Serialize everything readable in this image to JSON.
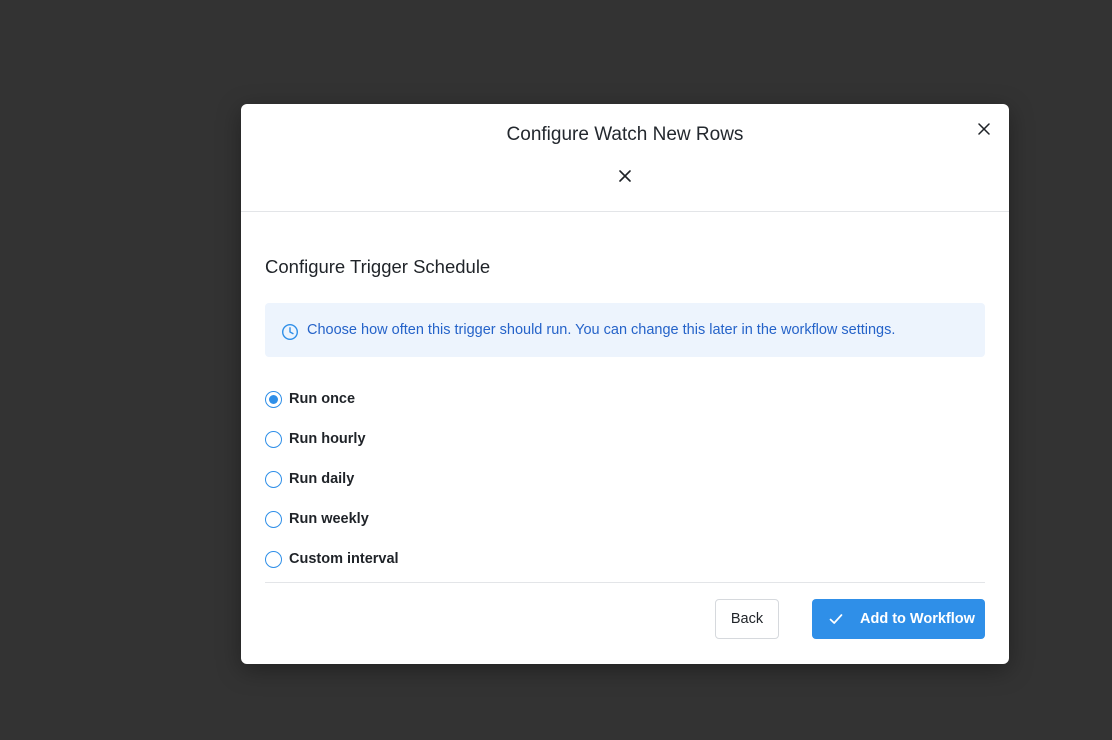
{
  "modal": {
    "title": "Configure Watch New Rows"
  },
  "schedule": {
    "heading": "Configure Trigger Schedule",
    "info_text": "Choose how often this trigger should run. You can change this later in the workflow settings.",
    "selected_index": 0,
    "options": [
      {
        "label": "Run once"
      },
      {
        "label": "Run hourly"
      },
      {
        "label": "Run daily"
      },
      {
        "label": "Run weekly"
      },
      {
        "label": "Custom interval"
      }
    ]
  },
  "footer": {
    "back_label": "Back",
    "add_label": "Add to Workflow"
  },
  "colors": {
    "overlay": "#333333",
    "accent": "#2f8fe8",
    "info_bg": "#edf4fd",
    "info_text": "#2563c9"
  },
  "icons": {
    "corner_close": "close-icon",
    "inner_close": "close-icon",
    "info": "clock-icon",
    "add": "check-icon"
  }
}
